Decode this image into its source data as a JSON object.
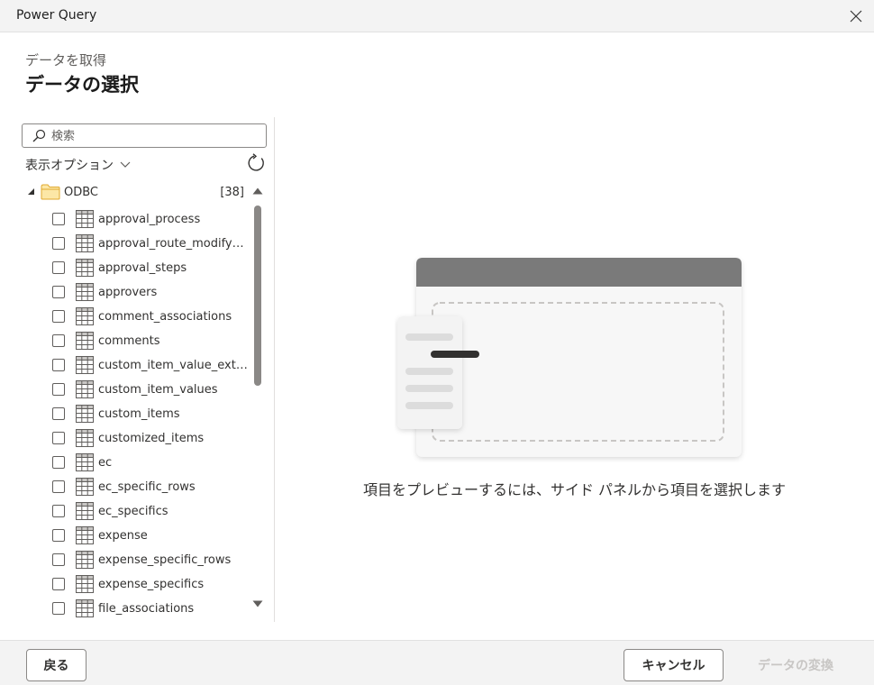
{
  "window": {
    "title": "Power Query"
  },
  "header": {
    "eyebrow": "データを取得",
    "title": "データの選択"
  },
  "search": {
    "placeholder": "検索",
    "value": ""
  },
  "options": {
    "label": "表示オプション"
  },
  "tree": {
    "root": {
      "name": "ODBC",
      "count": "[38]"
    },
    "items": [
      {
        "label": "approval_process"
      },
      {
        "label": "approval_route_modify_lo..."
      },
      {
        "label": "approval_steps"
      },
      {
        "label": "approvers"
      },
      {
        "label": "comment_associations"
      },
      {
        "label": "comments"
      },
      {
        "label": "custom_item_value_exten..."
      },
      {
        "label": "custom_item_values"
      },
      {
        "label": "custom_items"
      },
      {
        "label": "customized_items"
      },
      {
        "label": "ec"
      },
      {
        "label": "ec_specific_rows"
      },
      {
        "label": "ec_specifics"
      },
      {
        "label": "expense"
      },
      {
        "label": "expense_specific_rows"
      },
      {
        "label": "expense_specifics"
      },
      {
        "label": "file_associations"
      }
    ]
  },
  "preview": {
    "empty_message": "項目をプレビューするには、サイド パネルから項目を選択します"
  },
  "footer": {
    "back_label": "戻る",
    "cancel_label": "キャンセル",
    "transform_label": "データの変換"
  },
  "colors": {
    "folder": "#f6c44f",
    "scroll_thumb": "#8a8886",
    "disabled_text": "#c8c6c4"
  },
  "icons": {
    "close": "close-icon",
    "search": "search-icon",
    "refresh": "refresh-icon",
    "folder": "folder-icon",
    "table": "table-icon"
  }
}
